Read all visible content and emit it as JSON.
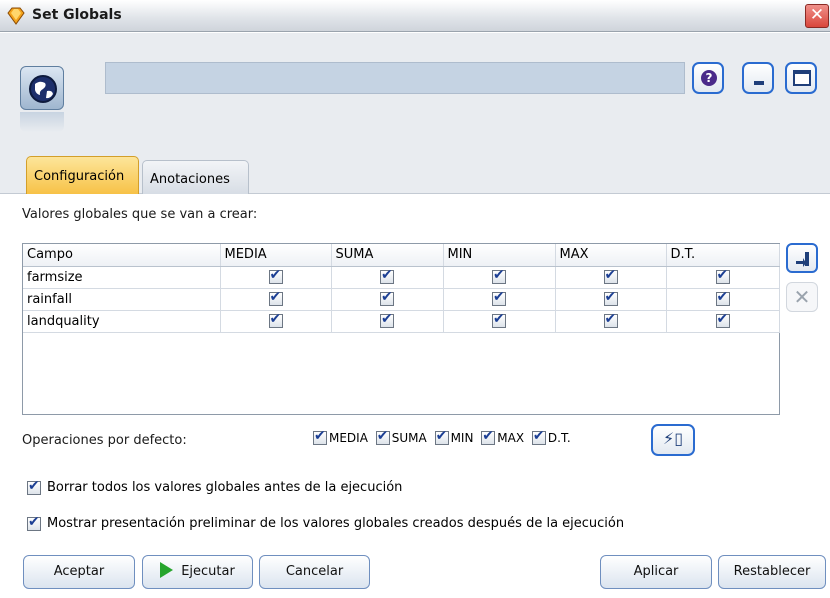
{
  "window": {
    "title": "Set Globals"
  },
  "tabs": [
    {
      "label": "Configuración",
      "active": true
    },
    {
      "label": "Anotaciones",
      "active": false
    }
  ],
  "section_label": "Valores globales que se van a crear:",
  "table": {
    "columns": [
      "Campo",
      "MEDIA",
      "SUMA",
      "MIN",
      "MAX",
      "D.T."
    ],
    "rows": [
      {
        "field": "farmsize",
        "checks": [
          true,
          true,
          true,
          true,
          true
        ]
      },
      {
        "field": "rainfall",
        "checks": [
          true,
          true,
          true,
          true,
          true
        ]
      },
      {
        "field": "landquality",
        "checks": [
          true,
          true,
          true,
          true,
          true
        ]
      }
    ]
  },
  "defaults": {
    "label": "Operaciones por defecto:",
    "ops": [
      "MEDIA",
      "SUMA",
      "MIN",
      "MAX",
      "D.T."
    ]
  },
  "options": {
    "clear_label": "Borrar todos los valores globales antes de la ejecución",
    "preview_label": "Mostrar presentación preliminar de los valores globales creados después de la ejecución"
  },
  "buttons": {
    "ok": "Aceptar",
    "run": "Ejecutar",
    "cancel": "Cancelar",
    "apply": "Aplicar",
    "reset": "Restablecer"
  },
  "icons": {
    "title": "gem-icon",
    "node": "globe-icon",
    "help": "help-icon",
    "close": "close-icon",
    "add_row": "add-row-icon",
    "delete_row": "delete-icon",
    "apply_defaults": "lightning-icon",
    "run": "play-icon"
  },
  "colors": {
    "active_tab": "#f7c247",
    "accent": "#2a6bd0",
    "run_green": "#27a52d"
  }
}
